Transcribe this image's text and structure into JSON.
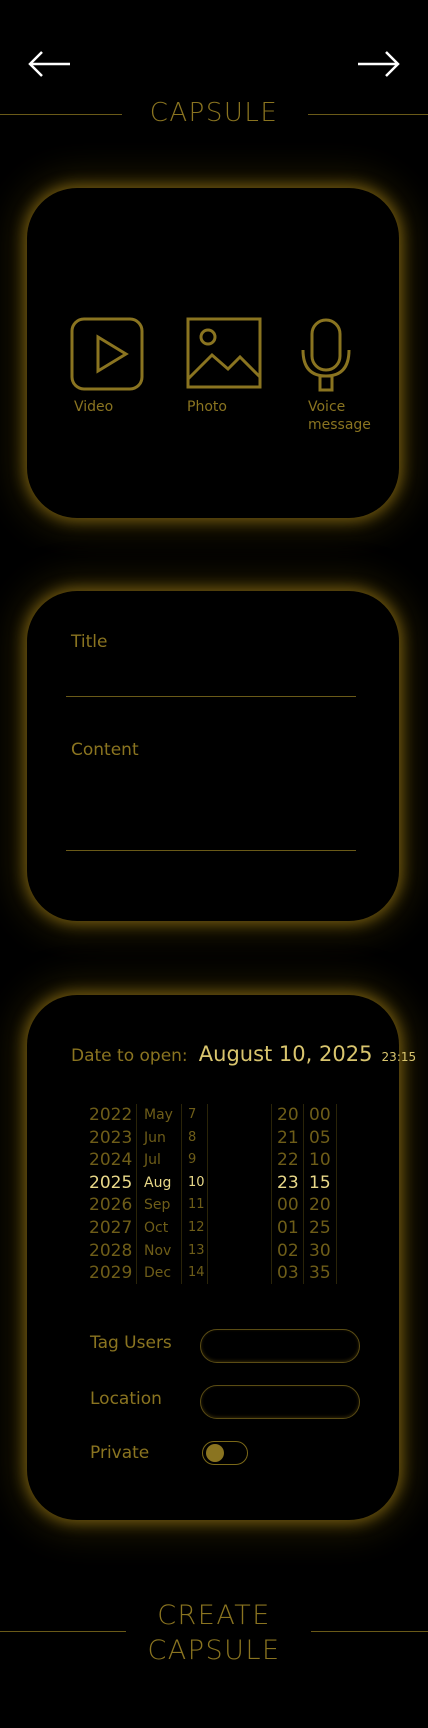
{
  "header": {
    "title": "CAPSULE",
    "back_icon": "arrow-left-icon",
    "forward_icon": "arrow-right-icon"
  },
  "media": {
    "items": [
      {
        "label": "Video",
        "icon": "play-icon"
      },
      {
        "label": "Photo",
        "icon": "image-icon"
      },
      {
        "label": "Voice message",
        "label_line1": "Voice",
        "label_line2": "message",
        "icon": "microphone-icon"
      }
    ]
  },
  "form": {
    "title_label": "Title",
    "title_value": "",
    "content_label": "Content",
    "content_value": ""
  },
  "schedule": {
    "date_label": "Date to open:",
    "date_value": "August 10, 2025",
    "time_value": "23:15",
    "picker": {
      "years": [
        "2022",
        "2023",
        "2024",
        "2025",
        "2026",
        "2027",
        "2028",
        "2029"
      ],
      "months": [
        "May",
        "Jun",
        "Jul",
        "Aug",
        "Sep",
        "Oct",
        "Nov",
        "Dec"
      ],
      "days": [
        "7",
        "8",
        "9",
        "10",
        "11",
        "12",
        "13",
        "14"
      ],
      "hours": [
        "20",
        "21",
        "22",
        "23",
        "00",
        "01",
        "02",
        "03"
      ],
      "minutes": [
        "00",
        "05",
        "10",
        "15",
        "20",
        "25",
        "30",
        "35"
      ]
    },
    "tag_users_label": "Tag Users",
    "tag_users_value": "",
    "location_label": "Location",
    "location_value": "",
    "private_label": "Private",
    "private_on": false
  },
  "footer": {
    "create_line1": "CREATE",
    "create_line2": "CAPSULE"
  },
  "colors": {
    "accent": "#8a7420",
    "highlight": "#e8d889",
    "background": "#000000"
  }
}
